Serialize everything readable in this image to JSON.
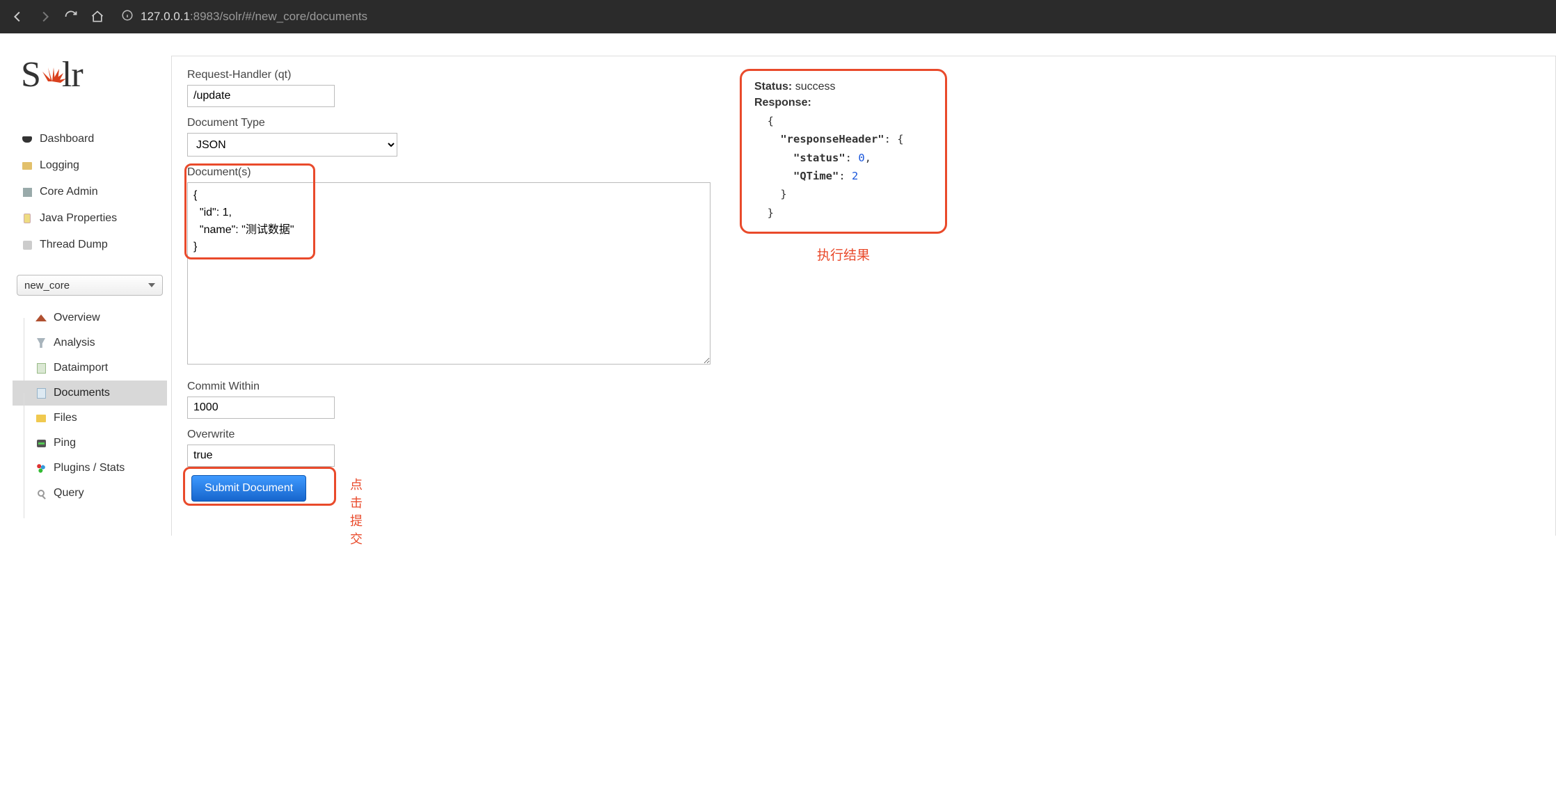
{
  "browser": {
    "url_display_host": "127.0.0.1",
    "url_display_port_path": ":8983/solr/#/new_core/documents"
  },
  "logo": {
    "text": "Solr"
  },
  "nav": {
    "dashboard": "Dashboard",
    "logging": "Logging",
    "core_admin": "Core Admin",
    "java_properties": "Java Properties",
    "thread_dump": "Thread Dump"
  },
  "core_selector": {
    "selected": "new_core"
  },
  "core_nav": {
    "overview": "Overview",
    "analysis": "Analysis",
    "dataimport": "Dataimport",
    "documents": "Documents",
    "files": "Files",
    "ping": "Ping",
    "plugins_stats": "Plugins / Stats",
    "query": "Query"
  },
  "form": {
    "request_handler_label": "Request-Handler (qt)",
    "request_handler_value": "/update",
    "document_type_label": "Document Type",
    "document_type_value": "JSON",
    "documents_label": "Document(s)",
    "documents_value": "{\n  \"id\": 1,\n  \"name\": \"测试数据\"\n}",
    "commit_within_label": "Commit Within",
    "commit_within_value": "1000",
    "overwrite_label": "Overwrite",
    "overwrite_value": "true",
    "submit_label": "Submit Document"
  },
  "annotations": {
    "submit_hint": "点击提交",
    "result_hint": "执行结果"
  },
  "result": {
    "status_label": "Status:",
    "status_value": "success",
    "response_label": "Response:",
    "json_key_responseHeader": "\"responseHeader\"",
    "json_key_status": "\"status\"",
    "json_val_status": "0",
    "json_key_qtime": "\"QTime\"",
    "json_val_qtime": "2"
  }
}
